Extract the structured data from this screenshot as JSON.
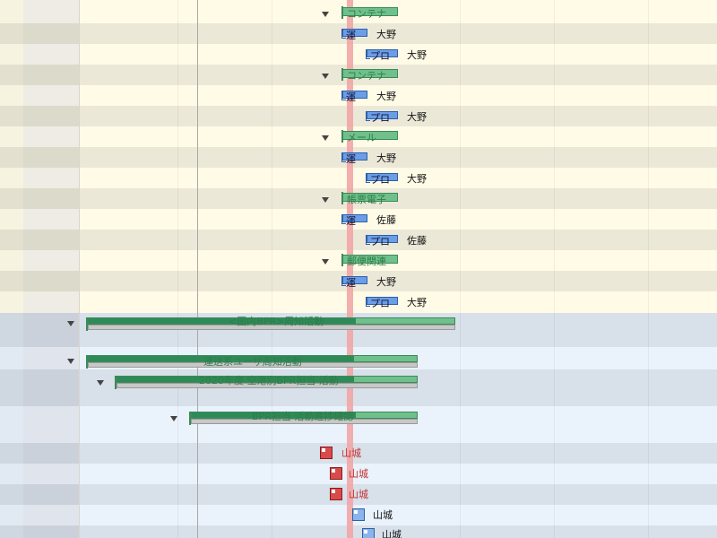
{
  "gantt": {
    "container_tasks": [
      {
        "label": "コンテナ",
        "owner": ""
      },
      {
        "label": "コンテナ",
        "owner": ""
      },
      {
        "label": "メール",
        "owner": ""
      },
      {
        "label": "帳票電子",
        "owner": ""
      },
      {
        "label": "郵便関連",
        "owner": ""
      }
    ],
    "ops_tasks": [
      {
        "label": "運",
        "owner": "大野"
      },
      {
        "label": "運",
        "owner": "大野"
      },
      {
        "label": "運",
        "owner": "大野"
      },
      {
        "label": "運",
        "owner": "佐藤"
      },
      {
        "label": "運",
        "owner": "大野"
      }
    ],
    "pro_tasks": [
      {
        "label": "プロ",
        "owner": "大野"
      },
      {
        "label": "プロ",
        "owner": "大野"
      },
      {
        "label": "プロ",
        "owner": "大野"
      },
      {
        "label": "プロ",
        "owner": "佐藤"
      },
      {
        "label": "プロ",
        "owner": "大野"
      }
    ],
    "summaries": [
      {
        "label": "<国内BPR>周知活動",
        "progress": 0.73
      },
      {
        "label": "運送系ユーザ周知活動",
        "progress": 0.81
      },
      {
        "label": "2020年度 空港別BPR担当 活動",
        "progress": 0.79
      },
      {
        "label": "BPR担当 活動進捗確認",
        "progress": 0.73
      }
    ],
    "milestones": [
      {
        "owner": "山城",
        "color": "#d94a4a"
      },
      {
        "owner": "山城",
        "color": "#d94a4a"
      },
      {
        "owner": "山城",
        "color": "#d94a4a"
      },
      {
        "owner": "山城",
        "color": "#8ab4ec"
      },
      {
        "owner": "山城",
        "color": "#8ab4ec"
      }
    ]
  }
}
